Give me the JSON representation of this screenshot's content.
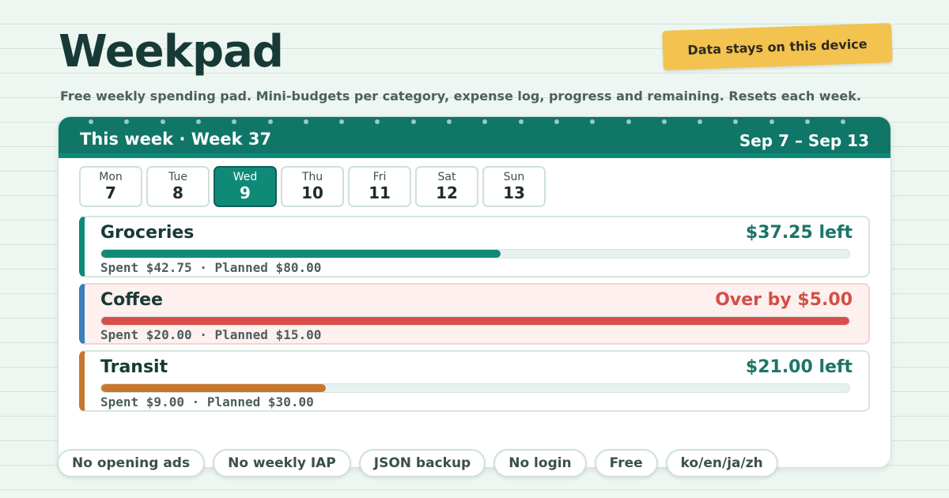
{
  "app": {
    "title": "Weekpad",
    "tagline": "Data stays on this device",
    "subtitle": "Free weekly spending pad. Mini-budgets per category, expense log, progress and remaining. Resets each week."
  },
  "header": {
    "left": "This week · Week 37",
    "right": "Sep 7 – Sep 13"
  },
  "days": [
    {
      "name": "Mon",
      "num": "7",
      "active": false
    },
    {
      "name": "Tue",
      "num": "8",
      "active": false
    },
    {
      "name": "Wed",
      "num": "9",
      "active": true
    },
    {
      "name": "Thu",
      "num": "10",
      "active": false
    },
    {
      "name": "Fri",
      "num": "11",
      "active": false
    },
    {
      "name": "Sat",
      "num": "12",
      "active": false
    },
    {
      "name": "Sun",
      "num": "13",
      "active": false
    }
  ],
  "categories": [
    {
      "name": "Groceries",
      "status": "$37.25 left",
      "detail": "Spent $42.75 · Planned $80.00",
      "progress": 0.534,
      "over": false,
      "color": "#0e8a78",
      "bar_color": "#138a78"
    },
    {
      "name": "Coffee",
      "status": "Over by $5.00",
      "detail": "Spent $20.00 · Planned $15.00",
      "progress": 1.0,
      "over": true,
      "color": "#3a7ebd",
      "bar_color": "#d94e4a"
    },
    {
      "name": "Transit",
      "status": "$21.00 left",
      "detail": "Spent $9.00 · Planned $30.00",
      "progress": 0.3,
      "over": false,
      "color": "#c8762e",
      "bar_color": "#c8762e"
    }
  ],
  "chips": [
    "No opening ads",
    "No weekly IAP",
    "JSON backup",
    "No login",
    "Free",
    "ko/en/ja/zh"
  ],
  "colors": {
    "header_bg": "#0f7668",
    "accent": "#108a78",
    "tagline_bg": "#f3c24f",
    "over_text": "#d44f47",
    "left_text": "#1b7568"
  }
}
